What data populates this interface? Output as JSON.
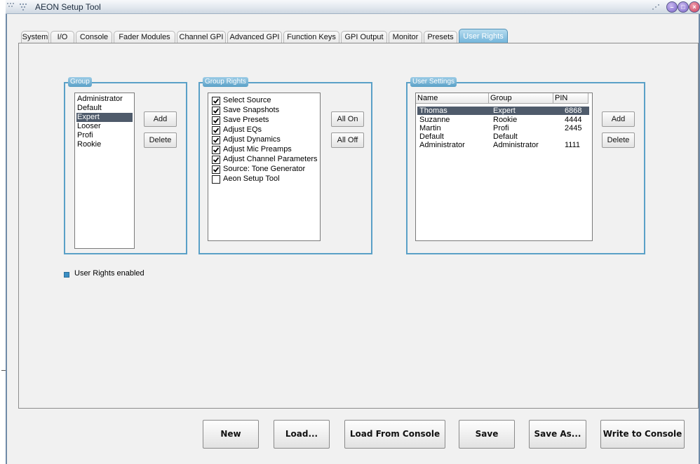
{
  "window": {
    "title": "AEON Setup Tool"
  },
  "tabs": [
    {
      "label": "System"
    },
    {
      "label": "I/O"
    },
    {
      "label": "Console"
    },
    {
      "label": "Fader Modules"
    },
    {
      "label": "Channel GPI"
    },
    {
      "label": "Advanced GPI"
    },
    {
      "label": "Function Keys"
    },
    {
      "label": "GPI Output"
    },
    {
      "label": "Monitor"
    },
    {
      "label": "Presets"
    },
    {
      "label": "User Rights",
      "active": true
    }
  ],
  "group_panel": {
    "title": "Group",
    "items": [
      "Administrator",
      "Default",
      "Expert",
      "Looser",
      "Profi",
      "Rookie"
    ],
    "selected": "Expert",
    "add_label": "Add",
    "delete_label": "Delete"
  },
  "rights_panel": {
    "title": "Group Rights",
    "items": [
      {
        "label": "Select Source",
        "checked": true
      },
      {
        "label": "Save Snapshots",
        "checked": true
      },
      {
        "label": "Save Presets",
        "checked": true
      },
      {
        "label": "Adjust EQs",
        "checked": true
      },
      {
        "label": "Adjust Dynamics",
        "checked": true
      },
      {
        "label": "Adjust Mic Preamps",
        "checked": true
      },
      {
        "label": "Adjust Channel Parameters",
        "checked": true
      },
      {
        "label": "Source: Tone Generator",
        "checked": true
      },
      {
        "label": "Aeon Setup Tool",
        "checked": false
      }
    ],
    "all_on_label": "All On",
    "all_off_label": "All Off"
  },
  "users_panel": {
    "title": "User Settings",
    "columns": [
      "Name",
      "Group",
      "PIN"
    ],
    "rows": [
      {
        "name": "Thomas",
        "group": "Expert",
        "pin": "6868",
        "selected": true
      },
      {
        "name": "Suzanne",
        "group": "Rookie",
        "pin": "4444"
      },
      {
        "name": "Martin",
        "group": "Profi",
        "pin": "2445"
      },
      {
        "name": "Default",
        "group": "Default",
        "pin": ""
      },
      {
        "name": "Administrator",
        "group": "Administrator",
        "pin": "1111"
      }
    ],
    "add_label": "Add",
    "delete_label": "Delete"
  },
  "user_rights_enabled_label": "User Rights enabled",
  "bottom_bar": {
    "new_label": "New",
    "load_label": "Load...",
    "load_console_label": "Load From Console",
    "save_label": "Save",
    "save_as_label": "Save As...",
    "write_console_label": "Write to Console"
  },
  "colors": {
    "accent": "#5aa0c7",
    "active_tab": "#6fb3d9",
    "selection": "#4f5b6b"
  }
}
